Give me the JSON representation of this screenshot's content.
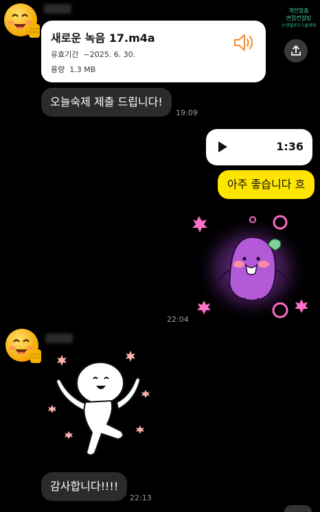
{
  "watermark": {
    "line1": "개인맞춤",
    "line2": "면접컨설팅",
    "line3": "©엔젤로우스쿨제제"
  },
  "chat": {
    "file": {
      "name": "새로운 녹음 17.m4a",
      "expiry_label": "유효기간",
      "expiry_value": "~2025. 6. 30.",
      "size_label": "용량",
      "size_value": "1.3 MB",
      "icon": "speaker-icon"
    },
    "share_icon": "share-icon",
    "msg1": {
      "text": "오늘숙제 제출 드립니다!",
      "time": "19:09"
    },
    "voice": {
      "duration": "1:36",
      "icon": "play-icon"
    },
    "msg2": {
      "text": "아주 좋습니다 흐"
    },
    "sticker1": {
      "time": "22:04"
    },
    "msg3": {
      "text": "감사합니다!!!!",
      "time": "22:13"
    }
  },
  "colors": {
    "background": "#000000",
    "bubble_dark": "#2b2b2b",
    "bubble_yellow": "#fee500",
    "bubble_white": "#ffffff",
    "speaker_orange": "#f0892f",
    "watermark_green": "#3fd3a0"
  }
}
